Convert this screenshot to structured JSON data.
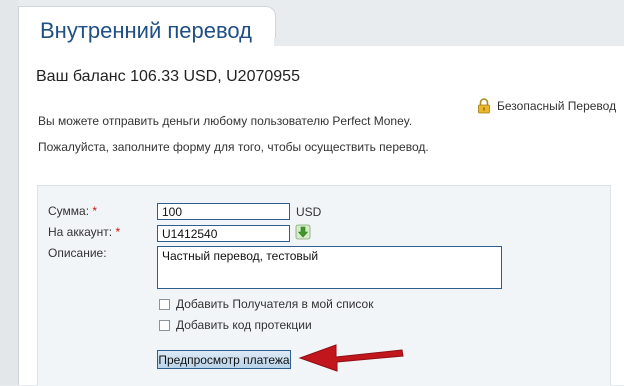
{
  "header": {
    "title": "Внутренний перевод"
  },
  "balance": {
    "text": "Ваш баланс 106.33 USD, U2070955"
  },
  "secure": {
    "label": "Безопасный Перевод",
    "icon": "lock-icon"
  },
  "intro": {
    "line1": "Вы можете отправить деньги любому пользователю Perfect Money.",
    "line2": "Пожалуйста, заполните форму для того, чтобы осуществить перевод."
  },
  "form": {
    "amount_label": "Сумма:",
    "amount_value": "100",
    "currency": "USD",
    "account_label": "На аккаунт:",
    "account_value": "U1412540",
    "required_mark": "*",
    "account_icon": "download-arrow-icon",
    "description_label": "Описание:",
    "description_value": "Частный перевод, тестовый",
    "add_recipient_label": "Добавить Получателя в мой список",
    "add_protection_label": "Добавить код протекции",
    "preview_button": "Предпросмотр платежа"
  },
  "colors": {
    "title": "#1f4f85",
    "required": "#cc1111",
    "arrow": "#c0161c",
    "field_border": "#2f5e8e"
  }
}
